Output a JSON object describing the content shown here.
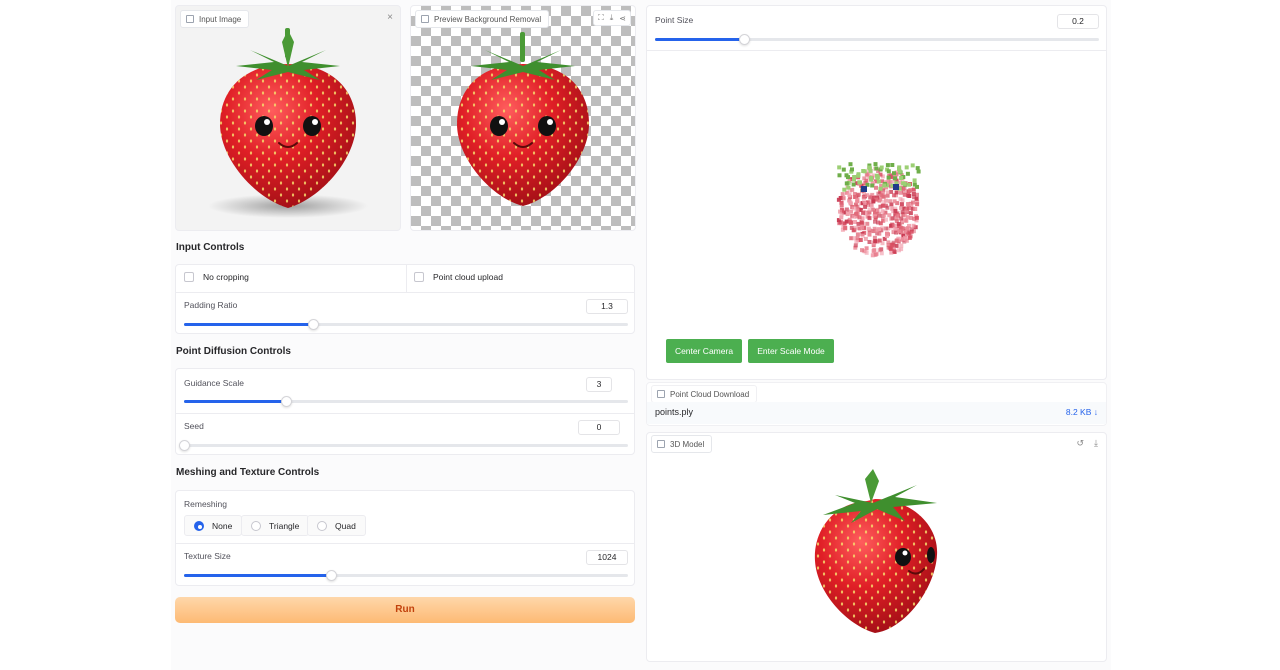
{
  "input_image": {
    "label": "Input Image"
  },
  "preview": {
    "label": "Preview Background Removal"
  },
  "input_controls": {
    "title": "Input Controls",
    "no_cropping": "No cropping",
    "point_cloud_upload": "Point cloud upload",
    "padding_ratio": {
      "label": "Padding Ratio",
      "value": "1.3",
      "level": 0.29
    }
  },
  "diffusion_controls": {
    "title": "Point Diffusion Controls",
    "guidance_scale": {
      "label": "Guidance Scale",
      "value": "3",
      "level": 0.23
    },
    "seed": {
      "label": "Seed",
      "value": "0",
      "level": 0.0
    }
  },
  "meshing_controls": {
    "title": "Meshing and Texture Controls",
    "remeshing": {
      "label": "Remeshing",
      "options": [
        "None",
        "Triangle",
        "Quad"
      ],
      "selected": "None"
    },
    "texture_size": {
      "label": "Texture Size",
      "value": "1024",
      "level": 0.33
    }
  },
  "run_button": "Run",
  "point_viewer": {
    "point_size": {
      "label": "Point Size",
      "value": "0.2",
      "level": 0.2
    },
    "center_camera": "Center Camera",
    "enter_scale_mode": "Enter Scale Mode"
  },
  "download": {
    "label": "Point Cloud Download",
    "filename": "points.ply",
    "size": "8.2 KB ↓"
  },
  "model": {
    "label": "3D Model"
  },
  "colors": {
    "accent": "#2563eb",
    "green": "#4caf50",
    "run": "#fdba74",
    "strawberry": "#d81e2a",
    "leaf": "#3f8f2e"
  },
  "icons": [
    "image-icon",
    "close-icon",
    "fullscreen-icon",
    "download-icon",
    "share-icon",
    "file-icon",
    "undo-icon",
    "cube-icon"
  ]
}
